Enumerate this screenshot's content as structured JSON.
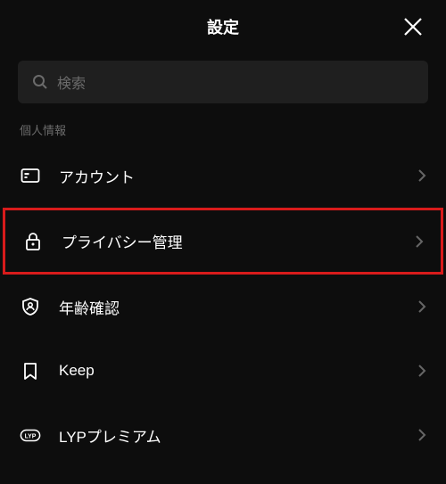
{
  "header": {
    "title": "設定"
  },
  "search": {
    "placeholder": "検索"
  },
  "section": {
    "label": "個人情報"
  },
  "items": [
    {
      "label": "アカウント"
    },
    {
      "label": "プライバシー管理"
    },
    {
      "label": "年齢確認"
    },
    {
      "label": "Keep"
    },
    {
      "label": "LYPプレミアム"
    }
  ]
}
